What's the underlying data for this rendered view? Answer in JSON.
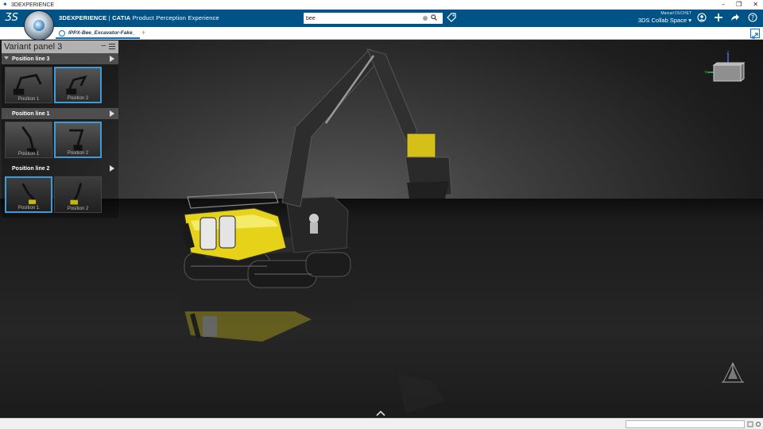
{
  "os": {
    "title": "3DEXPERIENCE",
    "controls": [
      "–",
      "❐",
      "✕"
    ]
  },
  "topbar": {
    "brand": "3DEXPERIENCE",
    "separator": " | ",
    "product": "CATIA",
    "app": "Product Perception Experience",
    "search_value": "bee",
    "user_name": "Manuel DUCHET",
    "collab_space": "3DS Collab Space",
    "icons": [
      "user-icon",
      "add-icon",
      "share-icon",
      "help-icon"
    ]
  },
  "tabs": {
    "doc_label": "IPPX-Bee_Excavator-Fake_",
    "add_label": "+"
  },
  "variant_panel": {
    "title": "Variant panel 3",
    "minimize": "–",
    "lines": [
      {
        "label": "Position line 3",
        "thumbs": [
          {
            "label": "Position 1",
            "selected": false
          },
          {
            "label": "Position 2",
            "selected": true
          }
        ]
      },
      {
        "label": "Position line 1",
        "thumbs": [
          {
            "label": "Position 1",
            "selected": false
          },
          {
            "label": "Position 2",
            "selected": true
          }
        ]
      },
      {
        "label": "Position line 2",
        "thumbs": [
          {
            "label": "Position 1",
            "selected": true
          },
          {
            "label": "Position 2",
            "selected": false
          }
        ]
      }
    ]
  },
  "compass_cube": {
    "z_label": "Z",
    "y_label": "Y"
  },
  "colors": {
    "topbar": "#005386",
    "accent": "#3e9bd8",
    "excavator_yellow": "#e6d219"
  }
}
